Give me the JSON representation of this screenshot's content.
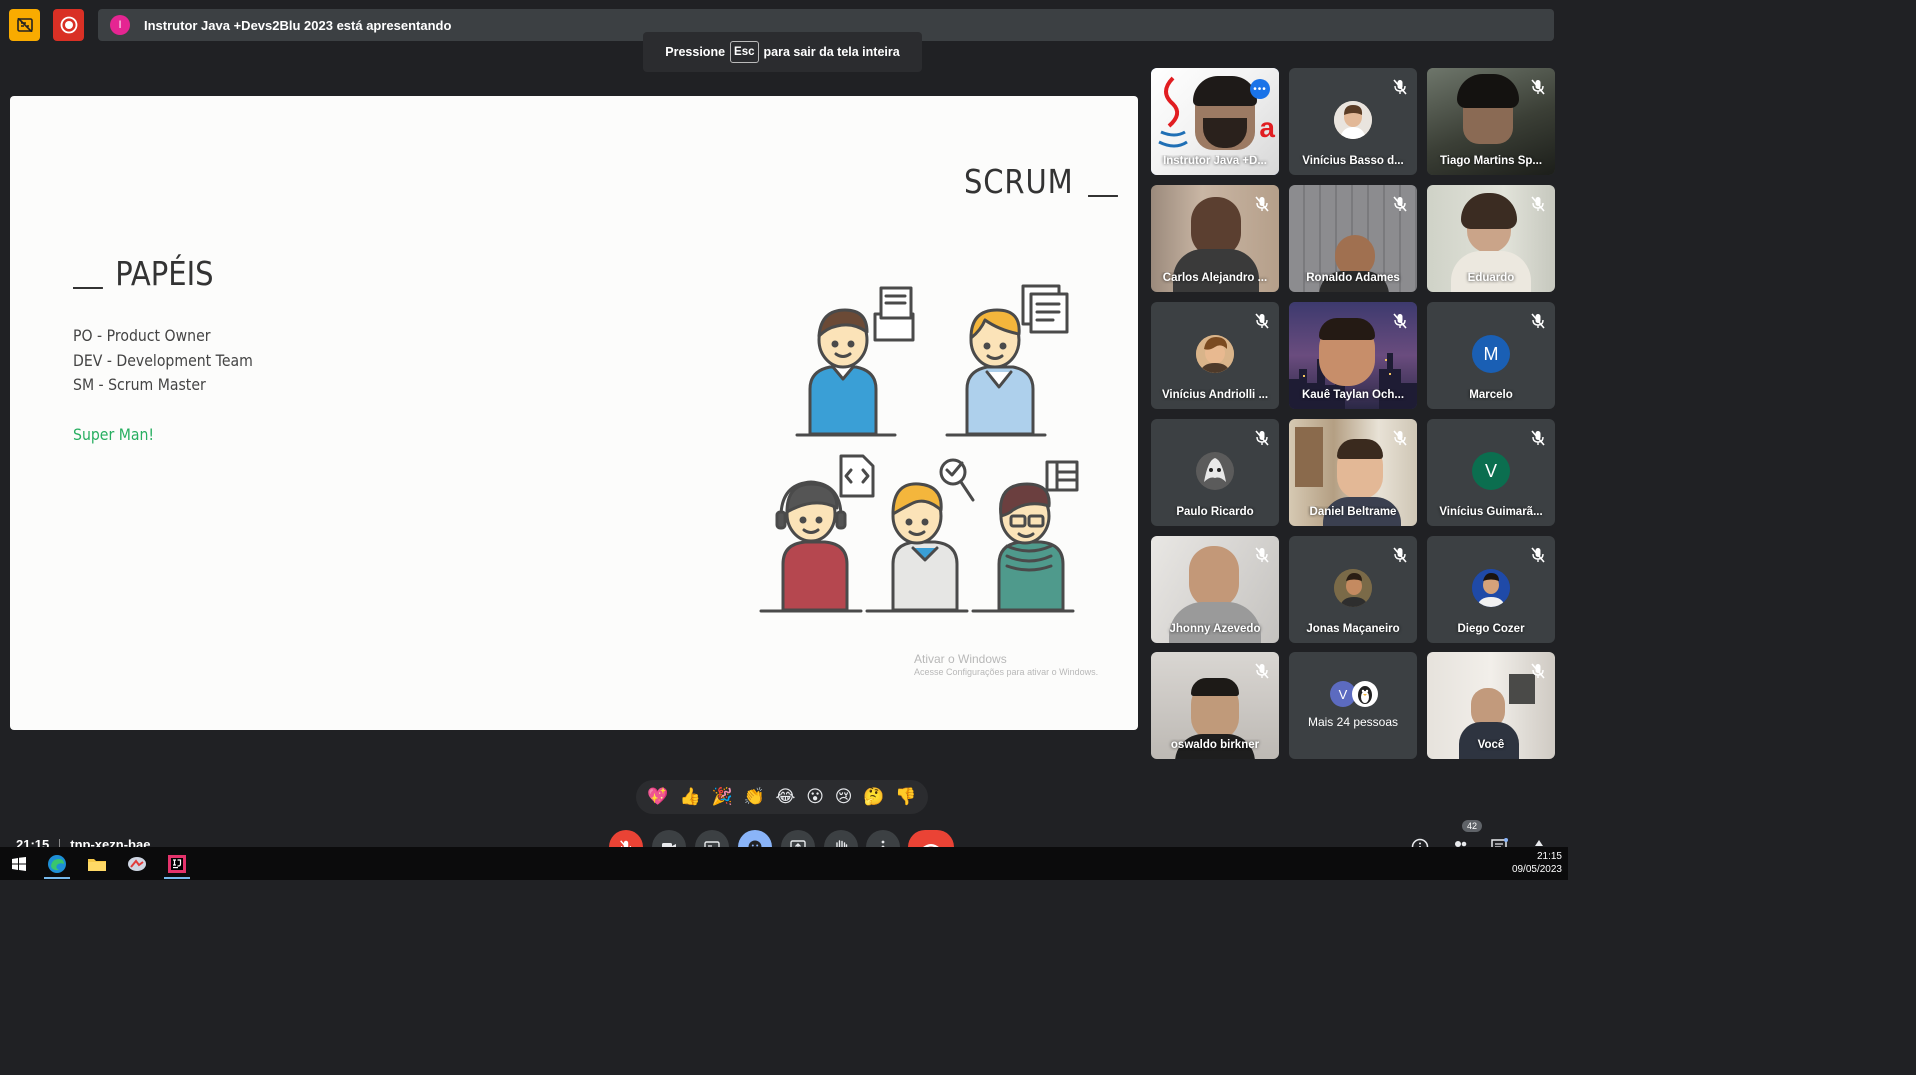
{
  "presenting": {
    "presenter_initial": "I",
    "text": "Instrutor Java +Devs2Blu 2023 está apresentando"
  },
  "fullscreen_toast": {
    "before": "Pressione",
    "key": "Esc",
    "after": "para sair da tela inteira"
  },
  "slide": {
    "title": "SCRUM",
    "section_heading": "PAPÉIS",
    "roles": [
      "PO - Product Owner",
      "DEV - Development Team",
      "SM - Scrum Master"
    ],
    "highlight": "Super Man!",
    "highlight_color": "#27ae60",
    "watermark_line1": "Ativar o Windows",
    "watermark_line2": "Acesse Configurações para ativar o Windows."
  },
  "participants": [
    {
      "name": "Instrutor Java +D...",
      "type": "video",
      "active": true,
      "muted": false
    },
    {
      "name": "Vinícius Basso d...",
      "type": "avatar",
      "muted": true
    },
    {
      "name": "Tiago Martins Sp...",
      "type": "video",
      "muted": true
    },
    {
      "name": "Carlos Alejandro ...",
      "type": "video",
      "muted": true
    },
    {
      "name": "Ronaldo Adames",
      "type": "video",
      "muted": true
    },
    {
      "name": "Eduardo",
      "type": "video",
      "muted": true
    },
    {
      "name": "Vinícius Andriolli ...",
      "type": "avatar",
      "muted": true
    },
    {
      "name": "Kauê Taylan Och...",
      "type": "video",
      "muted": true
    },
    {
      "name": "Marcelo",
      "type": "letter",
      "letter": "M",
      "color": "#1a5fb4",
      "muted": true
    },
    {
      "name": "Paulo Ricardo",
      "type": "avatar",
      "muted": true
    },
    {
      "name": "Daniel Beltrame",
      "type": "video",
      "muted": true
    },
    {
      "name": "Vinícius Guimarã...",
      "type": "letter",
      "letter": "V",
      "color": "#0b6e4f",
      "muted": true
    },
    {
      "name": "Jhonny Azevedo",
      "type": "video",
      "muted": true
    },
    {
      "name": "Jonas Maçaneiro",
      "type": "avatar",
      "muted": true
    },
    {
      "name": "Diego Cozer",
      "type": "avatar",
      "muted": true
    },
    {
      "name": "oswaldo birkner",
      "type": "video",
      "muted": true
    },
    {
      "name": "Mais 24 pessoas",
      "type": "more",
      "letter": "V"
    },
    {
      "name": "Você",
      "type": "video",
      "muted": true
    }
  ],
  "reactions": [
    "💖",
    "👍",
    "🎉",
    "👏",
    "😂",
    "😮",
    "😢",
    "🤔",
    "👎"
  ],
  "meeting": {
    "time": "21:15",
    "code": "tnp-xezn-bae"
  },
  "people_count": "42",
  "taskbar": {
    "time": "21:15",
    "date": "09/05/2023"
  },
  "icons": {
    "captions_off": "captions-off-icon",
    "record": "record-icon",
    "mic_off": "mic-off-icon"
  }
}
